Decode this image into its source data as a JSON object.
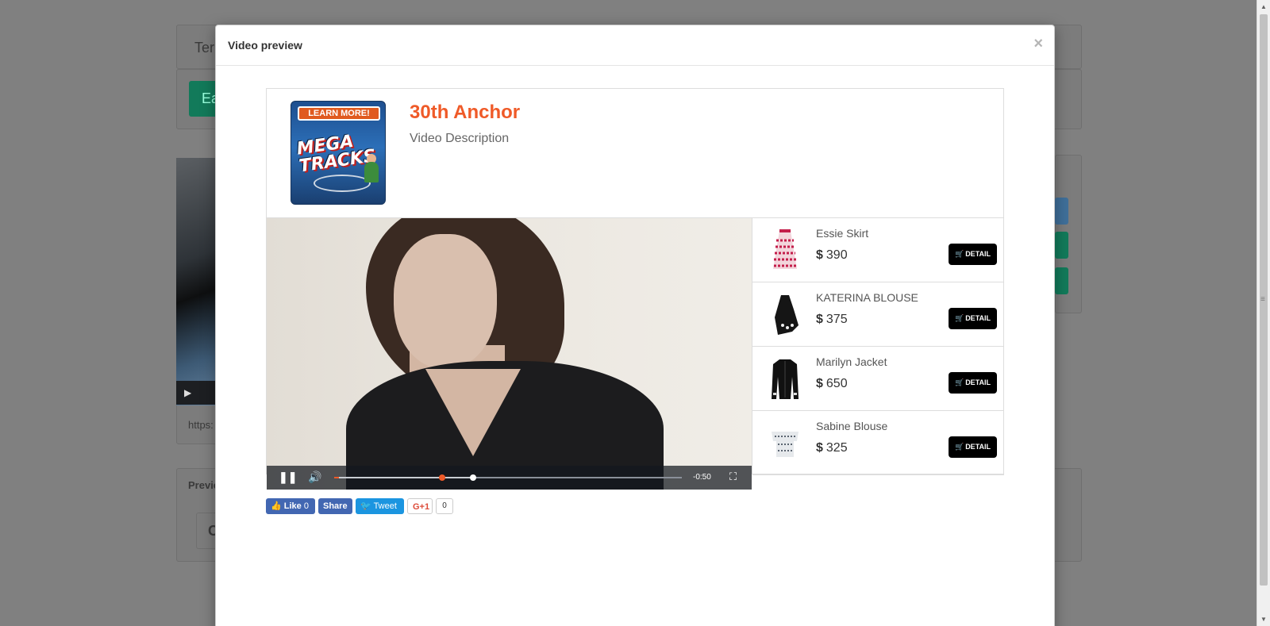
{
  "modal": {
    "title": "Video preview",
    "close": "×"
  },
  "video": {
    "title": "30th Anchor",
    "description": "Video Description",
    "thumbnail_text": "LEARN MORE!",
    "thumbnail_logo": "MEGA TRACKS",
    "time_remaining": "-0:50",
    "progress_played": 0.31,
    "progress_buffered": 0.4
  },
  "products": [
    {
      "name": "Essie Skirt",
      "currency": "$",
      "price": "390",
      "button": "DETAIL",
      "icon": "skirt-icon"
    },
    {
      "name": "KATERINA BLOUSE",
      "currency": "$",
      "price": "375",
      "button": "DETAIL",
      "icon": "blouse-icon"
    },
    {
      "name": "Marilyn Jacket",
      "currency": "$",
      "price": "650",
      "button": "DETAIL",
      "icon": "jacket-icon"
    },
    {
      "name": "Sabine Blouse",
      "currency": "$",
      "price": "325",
      "button": "DETAIL",
      "icon": "top-icon"
    }
  ],
  "social": {
    "fb_like": "Like",
    "fb_like_count": "0",
    "fb_share": "Share",
    "tweet": "Tweet",
    "gplus": "G+1",
    "gplus_count": "0"
  },
  "background": {
    "tab_text": "Ter",
    "button_text": "Ea",
    "url_text": "https:",
    "preview_label": "Previe",
    "box_text": "C"
  },
  "colors": {
    "accent": "#ef5a28",
    "detail_button": "#000000",
    "facebook": "#4267b2",
    "twitter": "#1b95e0"
  }
}
